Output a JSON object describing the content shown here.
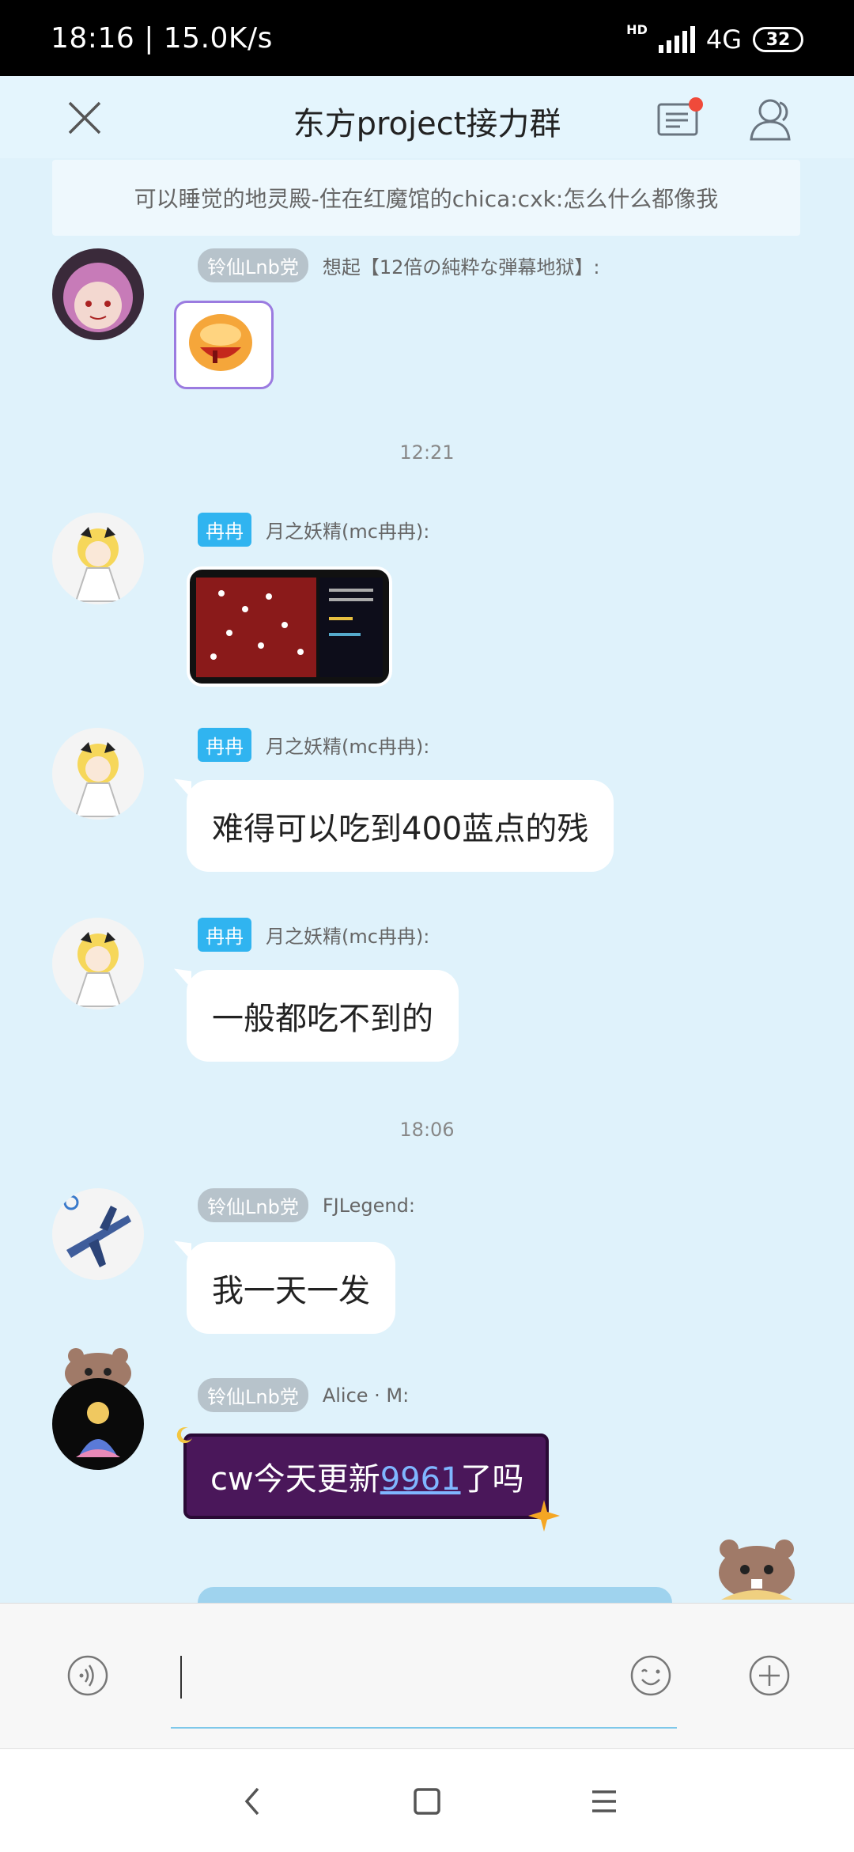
{
  "status_bar": {
    "time": "18:16",
    "speed": "15.0K/s",
    "hd": "HD",
    "network": "4G",
    "battery": "32"
  },
  "header": {
    "title": "东方project接力群"
  },
  "notice": {
    "text": "可以睡觉的地灵殿-住在红魔馆的chica:cxk:怎么什么都像我"
  },
  "messages": [
    {
      "tag": "铃仙Lnb党",
      "sender": "想起【12倍の純粋な弾幕地狱】:",
      "type": "sticker"
    },
    {
      "tag": "冉冉",
      "sender": "月之妖精(mc冉冉):",
      "type": "image"
    },
    {
      "tag": "冉冉",
      "sender": "月之妖精(mc冉冉):",
      "text": "难得可以吃到400蓝点的残"
    },
    {
      "tag": "冉冉",
      "sender": "月之妖精(mc冉冉):",
      "text": "一般都吃不到的"
    },
    {
      "tag": "铃仙Lnb党",
      "sender": "FJLegend:",
      "text": "我一天一发"
    },
    {
      "tag": "铃仙Lnb党",
      "sender": "Alice · M:",
      "text_before": "cw今天更新",
      "link": "9961",
      "text_after": "了吗"
    }
  ],
  "timestamps": [
    "12:21",
    "18:06"
  ],
  "colors": {
    "chat_background": "#dff2fb",
    "accent_blue": "#30b4f0",
    "notification_red": "#f04a3a",
    "special_bubble": "#4a175a"
  },
  "icons": {
    "close": "close-icon",
    "messages": "mail-icon",
    "members": "members-icon",
    "voice": "voice-icon",
    "emoji": "emoji-icon",
    "plus": "plus-icon",
    "back": "back-icon",
    "home": "home-icon",
    "menu": "menu-icon"
  }
}
